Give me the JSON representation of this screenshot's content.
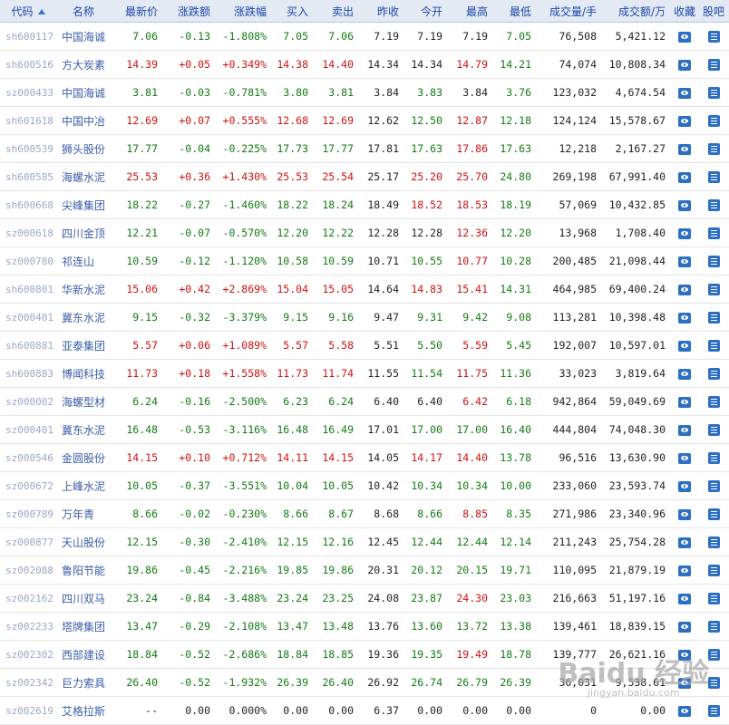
{
  "columns": {
    "code": "代码",
    "name": "名称",
    "price": "最新价",
    "change": "涨跌额",
    "pct": "涨跌幅",
    "bid": "买入",
    "ask": "卖出",
    "prev": "昨收",
    "open": "今开",
    "high": "最高",
    "low": "最低",
    "volume": "成交量/手",
    "turnover": "成交额/万",
    "fav": "收藏",
    "forum": "股吧"
  },
  "icons": {
    "sort": "sort-up-icon",
    "fav": "eye-icon",
    "forum": "list-icon"
  },
  "colors": {
    "up": "#d21010",
    "down": "#137a13",
    "header_bg": "#e4eaf4",
    "header_text": "#1a47a8",
    "icon_blue": "#2d6fc2"
  },
  "rows": [
    {
      "code": "sh600117",
      "name": "中国海诚",
      "price": "7.06",
      "change": "-0.13",
      "pct": "-1.808%",
      "bid": "7.05",
      "ask": "7.06",
      "prev": "7.19",
      "open": "7.19",
      "high": "7.19",
      "low": "7.05",
      "volume": "76,508",
      "turnover": "5,421.12",
      "dir": "down"
    },
    {
      "code": "sh600516",
      "name": "方大炭素",
      "price": "14.39",
      "change": "+0.05",
      "pct": "+0.349%",
      "bid": "14.38",
      "ask": "14.40",
      "prev": "14.34",
      "open": "14.34",
      "high": "14.79",
      "low": "14.21",
      "volume": "74,074",
      "turnover": "10,808.34",
      "dir": "up"
    },
    {
      "code": "sz000433",
      "name": "中国海诚",
      "price": "3.81",
      "change": "-0.03",
      "pct": "-0.781%",
      "bid": "3.80",
      "ask": "3.81",
      "prev": "3.84",
      "open": "3.83",
      "high": "3.84",
      "low": "3.76",
      "volume": "123,032",
      "turnover": "4,674.54",
      "dir": "down"
    },
    {
      "code": "sh601618",
      "name": "中国中冶",
      "price": "12.69",
      "change": "+0.07",
      "pct": "+0.555%",
      "bid": "12.68",
      "ask": "12.69",
      "prev": "12.62",
      "open": "12.50",
      "high": "12.87",
      "low": "12.18",
      "volume": "124,124",
      "turnover": "15,578.67",
      "dir": "up"
    },
    {
      "code": "sh600539",
      "name": "狮头股份",
      "price": "17.77",
      "change": "-0.04",
      "pct": "-0.225%",
      "bid": "17.73",
      "ask": "17.77",
      "prev": "17.81",
      "open": "17.63",
      "high": "17.86",
      "low": "17.63",
      "volume": "12,218",
      "turnover": "2,167.27",
      "dir": "down"
    },
    {
      "code": "sh600585",
      "name": "海螺水泥",
      "price": "25.53",
      "change": "+0.36",
      "pct": "+1.430%",
      "bid": "25.53",
      "ask": "25.54",
      "prev": "25.17",
      "open": "25.20",
      "high": "25.70",
      "low": "24.80",
      "volume": "269,198",
      "turnover": "67,991.40",
      "dir": "up"
    },
    {
      "code": "sh600668",
      "name": "尖峰集团",
      "price": "18.22",
      "change": "-0.27",
      "pct": "-1.460%",
      "bid": "18.22",
      "ask": "18.24",
      "prev": "18.49",
      "open": "18.52",
      "high": "18.53",
      "low": "18.19",
      "volume": "57,069",
      "turnover": "10,432.85",
      "dir": "down"
    },
    {
      "code": "sz000618",
      "name": "四川金顶",
      "price": "12.21",
      "change": "-0.07",
      "pct": "-0.570%",
      "bid": "12.20",
      "ask": "12.22",
      "prev": "12.28",
      "open": "12.28",
      "high": "12.36",
      "low": "12.20",
      "volume": "13,968",
      "turnover": "1,708.40",
      "dir": "down"
    },
    {
      "code": "sz000780",
      "name": "祁连山",
      "price": "10.59",
      "change": "-0.12",
      "pct": "-1.120%",
      "bid": "10.58",
      "ask": "10.59",
      "prev": "10.71",
      "open": "10.55",
      "high": "10.77",
      "low": "10.28",
      "volume": "200,485",
      "turnover": "21,098.44",
      "dir": "down"
    },
    {
      "code": "sh600801",
      "name": "华新水泥",
      "price": "15.06",
      "change": "+0.42",
      "pct": "+2.869%",
      "bid": "15.04",
      "ask": "15.05",
      "prev": "14.64",
      "open": "14.83",
      "high": "15.41",
      "low": "14.31",
      "volume": "464,985",
      "turnover": "69,400.24",
      "dir": "up"
    },
    {
      "code": "sz000401",
      "name": "冀东水泥",
      "price": "9.15",
      "change": "-0.32",
      "pct": "-3.379%",
      "bid": "9.15",
      "ask": "9.16",
      "prev": "9.47",
      "open": "9.31",
      "high": "9.42",
      "low": "9.08",
      "volume": "113,281",
      "turnover": "10,398.48",
      "dir": "down"
    },
    {
      "code": "sh600881",
      "name": "亚泰集团",
      "price": "5.57",
      "change": "+0.06",
      "pct": "+1.089%",
      "bid": "5.57",
      "ask": "5.58",
      "prev": "5.51",
      "open": "5.50",
      "high": "5.59",
      "low": "5.45",
      "volume": "192,007",
      "turnover": "10,597.01",
      "dir": "up"
    },
    {
      "code": "sh600883",
      "name": "博闻科技",
      "price": "11.73",
      "change": "+0.18",
      "pct": "+1.558%",
      "bid": "11.73",
      "ask": "11.74",
      "prev": "11.55",
      "open": "11.54",
      "high": "11.75",
      "low": "11.36",
      "volume": "33,023",
      "turnover": "3,819.64",
      "dir": "up"
    },
    {
      "code": "sz000002",
      "name": "海螺型材",
      "price": "6.24",
      "change": "-0.16",
      "pct": "-2.500%",
      "bid": "6.23",
      "ask": "6.24",
      "prev": "6.40",
      "open": "6.40",
      "high": "6.42",
      "low": "6.18",
      "volume": "942,864",
      "turnover": "59,049.69",
      "dir": "down"
    },
    {
      "code": "sz000401",
      "name": "冀东水泥",
      "price": "16.48",
      "change": "-0.53",
      "pct": "-3.116%",
      "bid": "16.48",
      "ask": "16.49",
      "prev": "17.01",
      "open": "17.00",
      "high": "17.00",
      "low": "16.40",
      "volume": "444,804",
      "turnover": "74,048.30",
      "dir": "down"
    },
    {
      "code": "sz000546",
      "name": "金圆股份",
      "price": "14.15",
      "change": "+0.10",
      "pct": "+0.712%",
      "bid": "14.11",
      "ask": "14.15",
      "prev": "14.05",
      "open": "14.17",
      "high": "14.40",
      "low": "13.78",
      "volume": "96,516",
      "turnover": "13,630.90",
      "dir": "up"
    },
    {
      "code": "sz000672",
      "name": "上峰水泥",
      "price": "10.05",
      "change": "-0.37",
      "pct": "-3.551%",
      "bid": "10.04",
      "ask": "10.05",
      "prev": "10.42",
      "open": "10.34",
      "high": "10.34",
      "low": "10.00",
      "volume": "233,060",
      "turnover": "23,593.74",
      "dir": "down"
    },
    {
      "code": "sz000789",
      "name": "万年青",
      "price": "8.66",
      "change": "-0.02",
      "pct": "-0.230%",
      "bid": "8.66",
      "ask": "8.67",
      "prev": "8.68",
      "open": "8.66",
      "high": "8.85",
      "low": "8.35",
      "volume": "271,986",
      "turnover": "23,340.96",
      "dir": "down"
    },
    {
      "code": "sz000877",
      "name": "天山股份",
      "price": "12.15",
      "change": "-0.30",
      "pct": "-2.410%",
      "bid": "12.15",
      "ask": "12.16",
      "prev": "12.45",
      "open": "12.44",
      "high": "12.44",
      "low": "12.14",
      "volume": "211,243",
      "turnover": "25,754.28",
      "dir": "down"
    },
    {
      "code": "sz002088",
      "name": "鲁阳节能",
      "price": "19.86",
      "change": "-0.45",
      "pct": "-2.216%",
      "bid": "19.85",
      "ask": "19.86",
      "prev": "20.31",
      "open": "20.12",
      "high": "20.15",
      "low": "19.71",
      "volume": "110,095",
      "turnover": "21,879.19",
      "dir": "down"
    },
    {
      "code": "sz002162",
      "name": "四川双马",
      "price": "23.24",
      "change": "-0.84",
      "pct": "-3.488%",
      "bid": "23.24",
      "ask": "23.25",
      "prev": "24.08",
      "open": "23.87",
      "high": "24.30",
      "low": "23.03",
      "volume": "216,663",
      "turnover": "51,197.16",
      "dir": "down"
    },
    {
      "code": "sz002233",
      "name": "塔牌集团",
      "price": "13.47",
      "change": "-0.29",
      "pct": "-2.108%",
      "bid": "13.47",
      "ask": "13.48",
      "prev": "13.76",
      "open": "13.60",
      "high": "13.72",
      "low": "13.38",
      "volume": "139,461",
      "turnover": "18,839.15",
      "dir": "down"
    },
    {
      "code": "sz002302",
      "name": "西部建设",
      "price": "18.84",
      "change": "-0.52",
      "pct": "-2.686%",
      "bid": "18.84",
      "ask": "18.85",
      "prev": "19.36",
      "open": "19.35",
      "high": "19.49",
      "low": "18.78",
      "volume": "139,777",
      "turnover": "26,621.16",
      "dir": "down"
    },
    {
      "code": "sz002342",
      "name": "巨力索具",
      "price": "26.40",
      "change": "-0.52",
      "pct": "-1.932%",
      "bid": "26.39",
      "ask": "26.40",
      "prev": "26.92",
      "open": "26.74",
      "high": "26.79",
      "low": "26.39",
      "volume": "36,031",
      "turnover": "9,538.61",
      "dir": "down"
    },
    {
      "code": "sz002619",
      "name": "艾格拉斯",
      "price": "--",
      "change": "0.00",
      "pct": "0.000%",
      "bid": "0.00",
      "ask": "0.00",
      "prev": "6.37",
      "open": "0.00",
      "high": "0.00",
      "low": "0.00",
      "volume": "0",
      "turnover": "0.00",
      "dir": "flat"
    }
  ],
  "watermark": {
    "brand": "Baidu 经验",
    "url": "jingyan.baidu.com"
  }
}
